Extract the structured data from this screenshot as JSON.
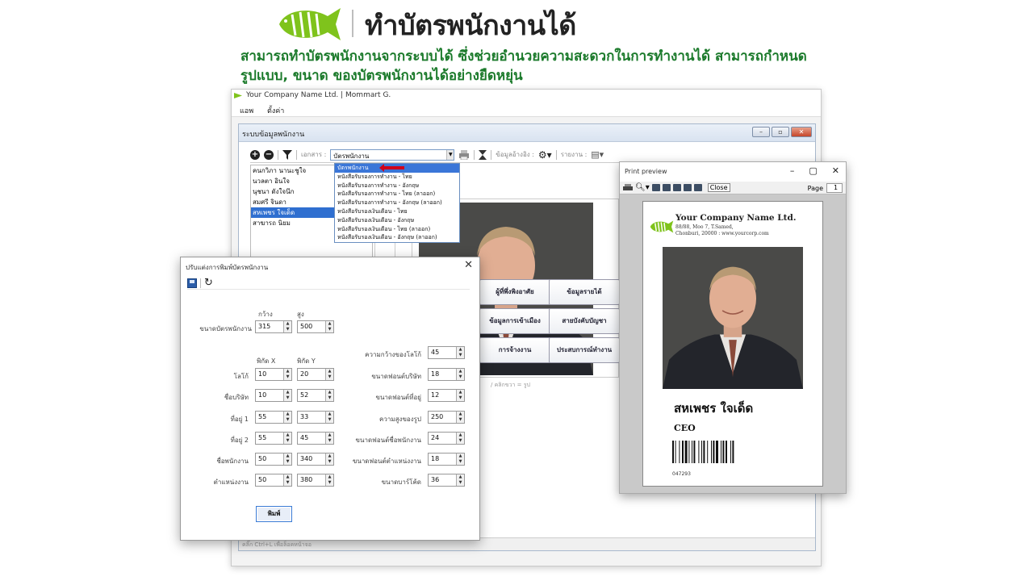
{
  "header": {
    "title": "ทำบัตรพนักงานได้",
    "desc_line1": "สามารถทำบัตรพนักงานจากระบบได้  ซึ่งช่วยอำนวยความสะดวกในการทำงานได้  สามารถกำหนด",
    "desc_line2": "รูปแบบ, ขนาด ของบัตรพนักงานได้อย่างยืดหยุ่น"
  },
  "app": {
    "window_title": "Your Company Name Ltd. | Mommart G.",
    "menu": [
      "แอพ",
      "ตั้งค่า"
    ],
    "subwin_title": "ระบบข้อมูลพนักงาน",
    "toolbar": {
      "doc_label": "เอกสาร :",
      "doc_value": "บัตรพนักงาน",
      "ref_label": "ข้อมูลอ้างอิง :",
      "report_label": "รายงาน :"
    },
    "dropdown": [
      "บัตรพนักงาน",
      "หนังสือรับรองการทำงาน - ไทย",
      "หนังสือรับรองการทำงาน - อังกฤษ",
      "หนังสือรับรองการทำงาน - ไทย (ลาออก)",
      "หนังสือรับรองการทำงาน - อังกฤษ (ลาออก)",
      "หนังสือรับรองเงินเดือน - ไทย",
      "หนังสือรับรองเงินเดือน - อังกฤษ",
      "หนังสือรับรองเงินเดือน - ไทย (ลาออก)",
      "หนังสือรับรองเงินเดือน - อังกฤษ (ลาออก)"
    ],
    "employees": [
      "คนกวิภา นานะชูใจ",
      "นวลตา อินใจ",
      "นุชนา ดังใจนึก",
      "สมศรี จินดา",
      "สหเพชร ใจเด็ด",
      "สาฆารถ นิยม"
    ],
    "selected_employee_index": 4,
    "photo_hint": "/ คลิกขวา = รูป",
    "tiles": [
      [
        "ผู้ที่พึ่งพิงอาศัย",
        "ข้อมูลรายได้"
      ],
      [
        "ข้อมูลการเข้าเมือง",
        "สายบังคับบัญชา"
      ],
      [
        "การจ้างงาน",
        "ประสบการณ์ทำงาน"
      ]
    ],
    "status_text": "คลิ๊ก Ctrl+L เพื่อล็อคหน้าจอ"
  },
  "dialog": {
    "title": "ปรับแต่งการพิมพ์บัตรพนักงาน",
    "col_width": "กว้าง",
    "col_height": "สูง",
    "card_size_label": "ขนาดบัตรพนักงาน",
    "card_width": "315",
    "card_height": "500",
    "col_x": "พิกัด X",
    "col_y": "พิกัด Y",
    "rows": [
      {
        "label": "โลโก้",
        "x": "10",
        "y": "20"
      },
      {
        "label": "ชื่อบริษัท",
        "x": "10",
        "y": "52"
      },
      {
        "label": "ที่อยู่ 1",
        "x": "55",
        "y": "33"
      },
      {
        "label": "ที่อยู่ 2",
        "x": "55",
        "y": "45"
      },
      {
        "label": "ชื่อพนักงาน",
        "x": "50",
        "y": "340"
      },
      {
        "label": "ตำแหน่งงาน",
        "x": "50",
        "y": "380"
      }
    ],
    "right_rows": [
      {
        "label": "ความกว้างของโลโก้",
        "value": "45"
      },
      {
        "label": "ขนาดฟอนต์บริษัท",
        "value": "18"
      },
      {
        "label": "ขนาดฟอนต์ที่อยู่",
        "value": "12"
      },
      {
        "label": "ความสูงของรูป",
        "value": "250"
      },
      {
        "label": "ขนาดฟอนต์ชื่อพนักงาน",
        "value": "24"
      },
      {
        "label": "ขนาดฟอนต์ตำแหน่งงาน",
        "value": "18"
      },
      {
        "label": "ขนาดบาร์โค้ด",
        "value": "36"
      }
    ],
    "print_label": "พิมพ์"
  },
  "preview": {
    "title": "Print preview",
    "close_label": "Close",
    "page_label": "Page",
    "page_value": "1",
    "company": "Your Company Name Ltd.",
    "addr1": "88/88, Moo 7, T.Samed,",
    "addr2": "Chonburi, 20000 : www.yourcorp.com",
    "employee_name": "สหเพชร ใจเด็ด",
    "position": "CEO",
    "barcode_number": "047293"
  },
  "colors": {
    "brand_green": "#7fc31c",
    "desc_green": "#1b7a2b",
    "selection_blue": "#2f6fd0",
    "arrow_red": "#d0021b"
  }
}
